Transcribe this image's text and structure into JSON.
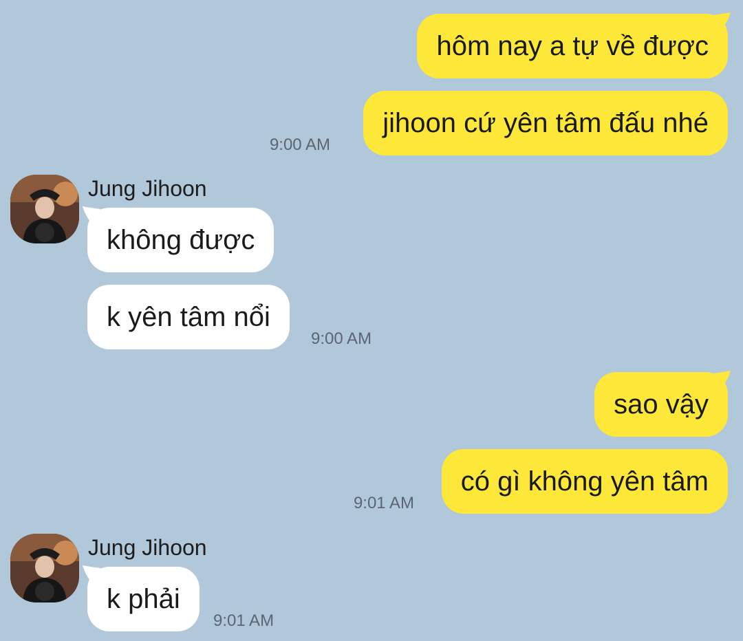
{
  "chat": {
    "messages": [
      {
        "direction": "out",
        "text": "hôm nay a tự về được"
      },
      {
        "direction": "out",
        "text": "jihoon cứ yên tâm đấu nhé",
        "time": "9:00 AM"
      },
      {
        "direction": "in",
        "sender": "Jung Jihoon",
        "text": "không được"
      },
      {
        "direction": "in",
        "text": "k yên tâm nổi",
        "time": "9:00 AM"
      },
      {
        "direction": "out",
        "text": "sao vậy"
      },
      {
        "direction": "out",
        "text": "có gì không yên tâm",
        "time": "9:01 AM"
      },
      {
        "direction": "in",
        "sender": "Jung Jihoon",
        "text": "k phải",
        "time": "9:01 AM"
      }
    ]
  },
  "colors": {
    "background": "#b1c7da",
    "outgoing_bubble": "#fde83a",
    "incoming_bubble": "#ffffff",
    "timestamp": "#5b6670"
  },
  "icons": {
    "avatar": "profile-photo"
  }
}
